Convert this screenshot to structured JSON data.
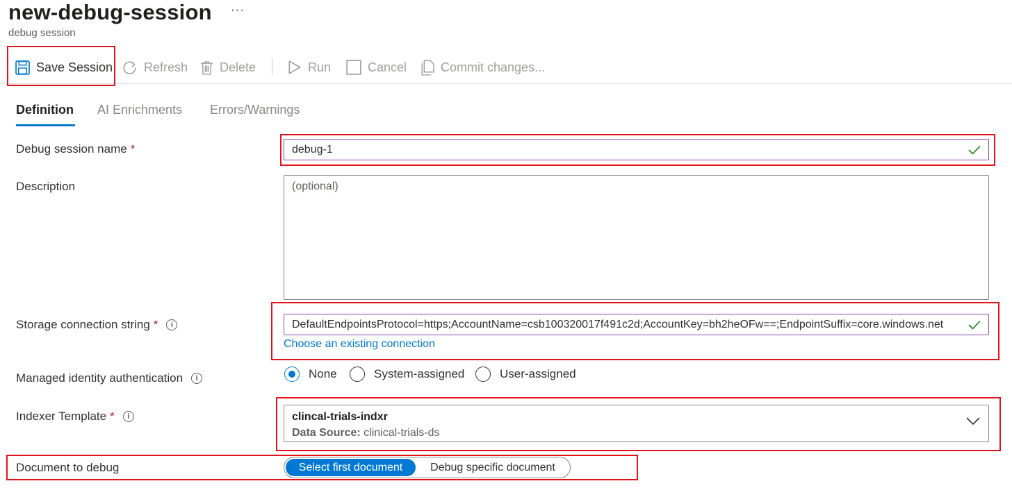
{
  "header": {
    "title": "new-debug-session",
    "more_label": "···",
    "subtitle": "debug session"
  },
  "toolbar": {
    "save_label": "Save Session",
    "refresh_label": "Refresh",
    "delete_label": "Delete",
    "run_label": "Run",
    "cancel_label": "Cancel",
    "commit_label": "Commit changes..."
  },
  "tabs": [
    {
      "label": "Definition",
      "active": true
    },
    {
      "label": "AI Enrichments",
      "active": false
    },
    {
      "label": "Errors/Warnings",
      "active": false
    }
  ],
  "form": {
    "session_name": {
      "label": "Debug session name",
      "required_mark": "*",
      "value": "debug-1"
    },
    "description": {
      "label": "Description",
      "placeholder": "(optional)",
      "value": ""
    },
    "storage": {
      "label": "Storage connection string",
      "required_mark": "*",
      "info": "i",
      "value": "DefaultEndpointsProtocol=https;AccountName=csb100320017f491c2d;AccountKey=bh2heOFw==;EndpointSuffix=core.windows.net",
      "link": "Choose an existing connection"
    },
    "identity": {
      "label": "Managed identity authentication",
      "info": "i",
      "options": [
        "None",
        "System-assigned",
        "User-assigned"
      ],
      "selected": "None"
    },
    "indexer": {
      "label": "Indexer Template",
      "required_mark": "*",
      "info": "i",
      "name": "clincal-trials-indxr",
      "ds_label": "Data Source:",
      "ds_value": "clinical-trials-ds"
    },
    "document": {
      "label": "Document to debug",
      "options": [
        "Select first document",
        "Debug specific document"
      ],
      "selected": "Select first document"
    }
  },
  "colors": {
    "accent": "#0078d4",
    "highlight": "#e2121b",
    "valid_check": "#107c10",
    "required": "#a4262c"
  }
}
